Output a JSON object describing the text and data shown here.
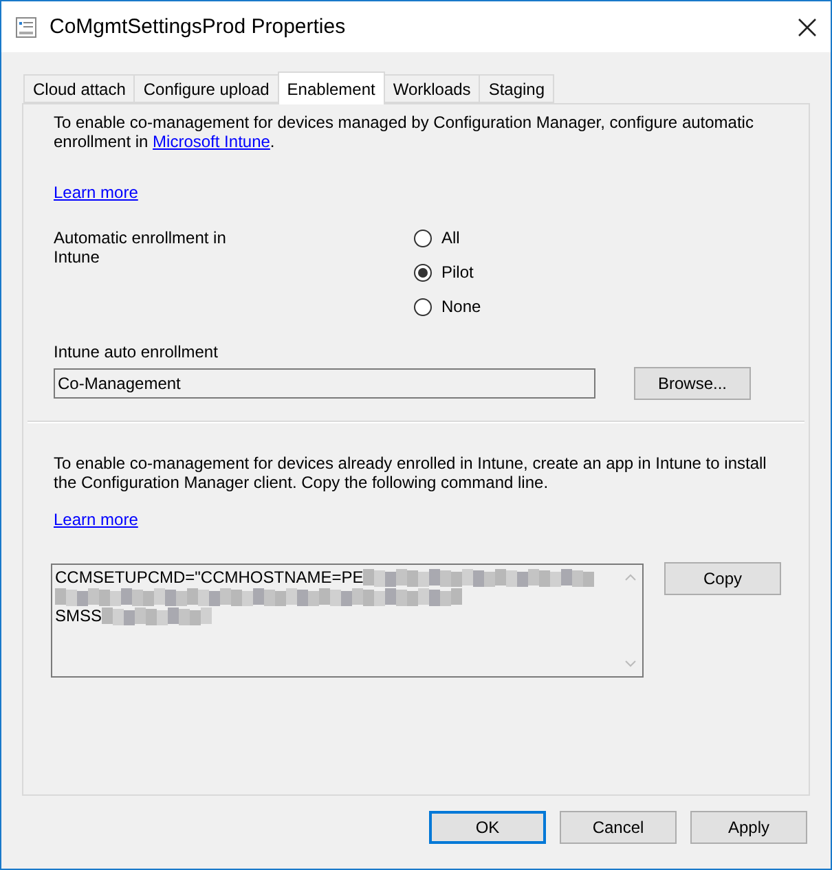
{
  "window": {
    "title": "CoMgmtSettingsProd Properties"
  },
  "tabs": [
    {
      "label": "Cloud attach",
      "selected": false
    },
    {
      "label": "Configure upload",
      "selected": false
    },
    {
      "label": "Enablement",
      "selected": true
    },
    {
      "label": "Workloads",
      "selected": false
    },
    {
      "label": "Staging",
      "selected": false
    }
  ],
  "auto_enrollment": {
    "intro_before_link": "To enable co-management for devices managed by Configuration Manager, configure automatic enrollment in ",
    "intro_link": "Microsoft Intune",
    "intro_after_link": ".",
    "learn_more": "Learn more",
    "label": "Automatic enrollment in Intune",
    "options": [
      {
        "label": "All",
        "selected": false
      },
      {
        "label": "Pilot",
        "selected": true
      },
      {
        "label": "None",
        "selected": false
      }
    ],
    "collection_label": "Intune auto enrollment",
    "collection_value": "Co-Management",
    "browse_button": "Browse..."
  },
  "client_install": {
    "intro": "To enable co-management for devices already enrolled in Intune, create an app in Intune to install the Configuration Manager client. Copy the following command line.",
    "learn_more": "Learn more",
    "command_lines": [
      "CCMSETUPCMD=\"CCMHOSTNAME=PE",
      "SMSS"
    ],
    "copy_button": "Copy"
  },
  "buttons": [
    {
      "label": "OK",
      "default": true
    },
    {
      "label": "Cancel",
      "default": false
    },
    {
      "label": "Apply",
      "default": false
    }
  ]
}
